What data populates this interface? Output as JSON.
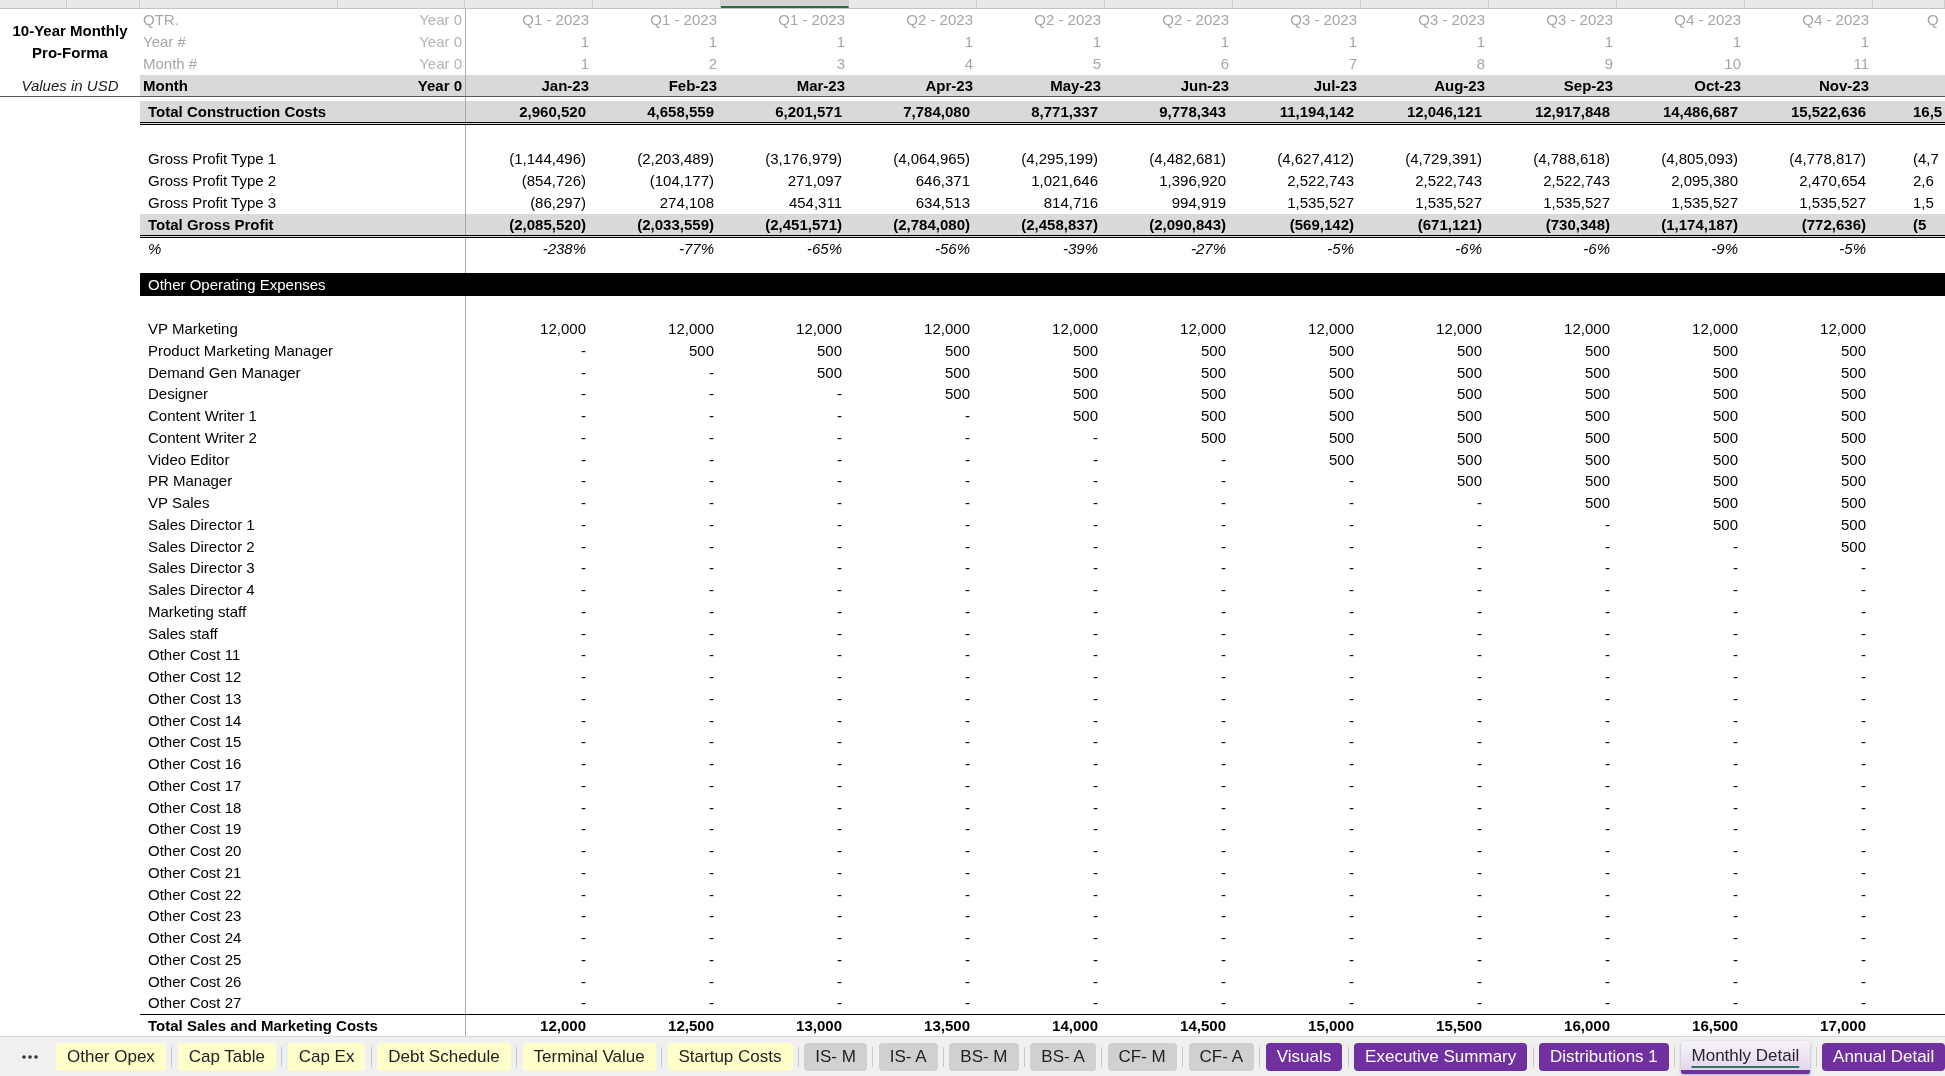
{
  "column_headers": [
    {
      "selected": false
    },
    {
      "selected": false
    },
    {
      "selected": true
    },
    {
      "selected": false
    },
    {
      "selected": false
    },
    {
      "selected": false
    },
    {
      "selected": false
    },
    {
      "selected": false
    },
    {
      "selected": false
    },
    {
      "selected": false
    },
    {
      "selected": false
    },
    {
      "selected": false
    }
  ],
  "title": "10-Year Monthly Pro-Forma",
  "units": "Values in USD",
  "header_rows": [
    {
      "kind": "index",
      "label": "QTR.",
      "base": "Year 0",
      "values": [
        "Q1 - 2023",
        "Q1 - 2023",
        "Q1 - 2023",
        "Q2 - 2023",
        "Q2 - 2023",
        "Q2 - 2023",
        "Q3 - 2023",
        "Q3 - 2023",
        "Q3 - 2023",
        "Q4 - 2023",
        "Q4 - 2023",
        "Q"
      ]
    },
    {
      "kind": "index",
      "label": "Year #",
      "base": "Year 0",
      "values": [
        "1",
        "1",
        "1",
        "1",
        "1",
        "1",
        "1",
        "1",
        "1",
        "1",
        "1"
      ]
    },
    {
      "kind": "index",
      "label": "Month #",
      "base": "Year 0",
      "values": [
        "1",
        "2",
        "3",
        "4",
        "5",
        "6",
        "7",
        "8",
        "9",
        "10",
        "11"
      ]
    },
    {
      "kind": "heading",
      "label": "Month",
      "base": "Year 0",
      "values": [
        "Jan-23",
        "Feb-23",
        "Mar-23",
        "Apr-23",
        "May-23",
        "Jun-23",
        "Jul-23",
        "Aug-23",
        "Sep-23",
        "Oct-23",
        "Nov-23"
      ]
    }
  ],
  "construction": [
    {
      "kind": "total",
      "label": "Total Construction Costs",
      "values": [
        "2,960,520",
        "4,658,559",
        "6,201,571",
        "7,784,080",
        "8,771,337",
        "9,778,343",
        "11,194,142",
        "12,046,121",
        "12,917,848",
        "14,486,687",
        "15,522,636",
        "16,5"
      ]
    }
  ],
  "gross_profit": [
    {
      "kind": "line",
      "label": "Gross Profit Type 1",
      "values": [
        "(1,144,496)",
        "(2,203,489)",
        "(3,176,979)",
        "(4,064,965)",
        "(4,295,199)",
        "(4,482,681)",
        "(4,627,412)",
        "(4,729,391)",
        "(4,788,618)",
        "(4,805,093)",
        "(4,778,817)",
        "(4,7"
      ]
    },
    {
      "kind": "line",
      "label": "Gross Profit Type 2",
      "values": [
        "(854,726)",
        "(104,177)",
        "271,097",
        "646,371",
        "1,021,646",
        "1,396,920",
        "2,522,743",
        "2,522,743",
        "2,522,743",
        "2,095,380",
        "2,470,654",
        "2,6"
      ]
    },
    {
      "kind": "line",
      "label": "Gross Profit Type 3",
      "values": [
        "(86,297)",
        "274,108",
        "454,311",
        "634,513",
        "814,716",
        "994,919",
        "1,535,527",
        "1,535,527",
        "1,535,527",
        "1,535,527",
        "1,535,527",
        "1,5"
      ]
    },
    {
      "kind": "total",
      "label": "Total Gross Profit",
      "values": [
        "(2,085,520)",
        "(2,033,559)",
        "(2,451,571)",
        "(2,784,080)",
        "(2,458,837)",
        "(2,090,843)",
        "(569,142)",
        "(671,121)",
        "(730,348)",
        "(1,174,187)",
        "(772,636)",
        "(5"
      ]
    },
    {
      "kind": "percent",
      "label": "%",
      "values": [
        "-238%",
        "-77%",
        "-65%",
        "-56%",
        "-39%",
        "-27%",
        "-5%",
        "-6%",
        "-6%",
        "-9%",
        "-5%"
      ]
    }
  ],
  "section": {
    "title": "Other Operating Expenses"
  },
  "expenses": [
    {
      "kind": "line",
      "label": "VP Marketing",
      "values": [
        "12,000",
        "12,000",
        "12,000",
        "12,000",
        "12,000",
        "12,000",
        "12,000",
        "12,000",
        "12,000",
        "12,000",
        "12,000"
      ]
    },
    {
      "kind": "line",
      "label": "Product Marketing Manager",
      "values": [
        "-",
        "500",
        "500",
        "500",
        "500",
        "500",
        "500",
        "500",
        "500",
        "500",
        "500"
      ]
    },
    {
      "kind": "line",
      "label": "Demand Gen Manager",
      "values": [
        "-",
        "-",
        "500",
        "500",
        "500",
        "500",
        "500",
        "500",
        "500",
        "500",
        "500"
      ]
    },
    {
      "kind": "line",
      "label": "Designer",
      "values": [
        "-",
        "-",
        "-",
        "500",
        "500",
        "500",
        "500",
        "500",
        "500",
        "500",
        "500"
      ]
    },
    {
      "kind": "line",
      "label": "Content Writer 1",
      "values": [
        "-",
        "-",
        "-",
        "-",
        "500",
        "500",
        "500",
        "500",
        "500",
        "500",
        "500"
      ]
    },
    {
      "kind": "line",
      "label": "Content Writer 2",
      "values": [
        "-",
        "-",
        "-",
        "-",
        "-",
        "500",
        "500",
        "500",
        "500",
        "500",
        "500"
      ]
    },
    {
      "kind": "line",
      "label": "Video Editor",
      "values": [
        "-",
        "-",
        "-",
        "-",
        "-",
        "-",
        "500",
        "500",
        "500",
        "500",
        "500"
      ]
    },
    {
      "kind": "line",
      "label": "PR Manager",
      "values": [
        "-",
        "-",
        "-",
        "-",
        "-",
        "-",
        "-",
        "500",
        "500",
        "500",
        "500"
      ]
    },
    {
      "kind": "line",
      "label": "VP Sales",
      "values": [
        "-",
        "-",
        "-",
        "-",
        "-",
        "-",
        "-",
        "-",
        "500",
        "500",
        "500"
      ]
    },
    {
      "kind": "line",
      "label": "Sales Director 1",
      "values": [
        "-",
        "-",
        "-",
        "-",
        "-",
        "-",
        "-",
        "-",
        "-",
        "500",
        "500"
      ]
    },
    {
      "kind": "line",
      "label": "Sales Director 2",
      "values": [
        "-",
        "-",
        "-",
        "-",
        "-",
        "-",
        "-",
        "-",
        "-",
        "-",
        "500"
      ]
    },
    {
      "kind": "line",
      "label": "Sales Director 3",
      "values": [
        "-",
        "-",
        "-",
        "-",
        "-",
        "-",
        "-",
        "-",
        "-",
        "-",
        "-"
      ]
    },
    {
      "kind": "line",
      "label": "Sales Director 4",
      "values": [
        "-",
        "-",
        "-",
        "-",
        "-",
        "-",
        "-",
        "-",
        "-",
        "-",
        "-"
      ]
    },
    {
      "kind": "line",
      "label": "Marketing staff",
      "values": [
        "-",
        "-",
        "-",
        "-",
        "-",
        "-",
        "-",
        "-",
        "-",
        "-",
        "-"
      ]
    },
    {
      "kind": "line",
      "label": "Sales staff",
      "values": [
        "-",
        "-",
        "-",
        "-",
        "-",
        "-",
        "-",
        "-",
        "-",
        "-",
        "-"
      ]
    },
    {
      "kind": "line",
      "label": "Other Cost 11",
      "values": [
        "-",
        "-",
        "-",
        "-",
        "-",
        "-",
        "-",
        "-",
        "-",
        "-",
        "-"
      ]
    },
    {
      "kind": "line",
      "label": "Other Cost 12",
      "values": [
        "-",
        "-",
        "-",
        "-",
        "-",
        "-",
        "-",
        "-",
        "-",
        "-",
        "-"
      ]
    },
    {
      "kind": "line",
      "label": "Other Cost 13",
      "values": [
        "-",
        "-",
        "-",
        "-",
        "-",
        "-",
        "-",
        "-",
        "-",
        "-",
        "-"
      ]
    },
    {
      "kind": "line",
      "label": "Other Cost 14",
      "values": [
        "-",
        "-",
        "-",
        "-",
        "-",
        "-",
        "-",
        "-",
        "-",
        "-",
        "-"
      ]
    },
    {
      "kind": "line",
      "label": "Other Cost 15",
      "values": [
        "-",
        "-",
        "-",
        "-",
        "-",
        "-",
        "-",
        "-",
        "-",
        "-",
        "-"
      ]
    },
    {
      "kind": "line",
      "label": "Other Cost 16",
      "values": [
        "-",
        "-",
        "-",
        "-",
        "-",
        "-",
        "-",
        "-",
        "-",
        "-",
        "-"
      ]
    },
    {
      "kind": "line",
      "label": "Other Cost 17",
      "values": [
        "-",
        "-",
        "-",
        "-",
        "-",
        "-",
        "-",
        "-",
        "-",
        "-",
        "-"
      ]
    },
    {
      "kind": "line",
      "label": "Other Cost 18",
      "values": [
        "-",
        "-",
        "-",
        "-",
        "-",
        "-",
        "-",
        "-",
        "-",
        "-",
        "-"
      ]
    },
    {
      "kind": "line",
      "label": "Other Cost 19",
      "values": [
        "-",
        "-",
        "-",
        "-",
        "-",
        "-",
        "-",
        "-",
        "-",
        "-",
        "-"
      ]
    },
    {
      "kind": "line",
      "label": "Other Cost 20",
      "values": [
        "-",
        "-",
        "-",
        "-",
        "-",
        "-",
        "-",
        "-",
        "-",
        "-",
        "-"
      ]
    },
    {
      "kind": "line",
      "label": "Other Cost 21",
      "values": [
        "-",
        "-",
        "-",
        "-",
        "-",
        "-",
        "-",
        "-",
        "-",
        "-",
        "-"
      ]
    },
    {
      "kind": "line",
      "label": "Other Cost 22",
      "values": [
        "-",
        "-",
        "-",
        "-",
        "-",
        "-",
        "-",
        "-",
        "-",
        "-",
        "-"
      ]
    },
    {
      "kind": "line",
      "label": "Other Cost 23",
      "values": [
        "-",
        "-",
        "-",
        "-",
        "-",
        "-",
        "-",
        "-",
        "-",
        "-",
        "-"
      ]
    },
    {
      "kind": "line",
      "label": "Other Cost 24",
      "values": [
        "-",
        "-",
        "-",
        "-",
        "-",
        "-",
        "-",
        "-",
        "-",
        "-",
        "-"
      ]
    },
    {
      "kind": "line",
      "label": "Other Cost 25",
      "values": [
        "-",
        "-",
        "-",
        "-",
        "-",
        "-",
        "-",
        "-",
        "-",
        "-",
        "-"
      ]
    },
    {
      "kind": "line",
      "label": "Other Cost 26",
      "values": [
        "-",
        "-",
        "-",
        "-",
        "-",
        "-",
        "-",
        "-",
        "-",
        "-",
        "-"
      ]
    },
    {
      "kind": "line",
      "label": "Other Cost 27",
      "values": [
        "-",
        "-",
        "-",
        "-",
        "-",
        "-",
        "-",
        "-",
        "-",
        "-",
        "-"
      ]
    },
    {
      "kind": "sum",
      "label": "Total Sales and Marketing Costs",
      "values": [
        "12,000",
        "12,500",
        "13,000",
        "13,500",
        "14,000",
        "14,500",
        "15,000",
        "15,500",
        "16,000",
        "16,500",
        "17,000"
      ]
    }
  ],
  "sheet_tabs": [
    {
      "label": "Other Opex",
      "color": "#ffffcc",
      "selected": false
    },
    {
      "label": "Cap Table",
      "color": "#ffffcc",
      "selected": false
    },
    {
      "label": "Cap Ex",
      "color": "#ffffcc",
      "selected": false
    },
    {
      "label": "Debt Schedule",
      "color": "#ffffcc",
      "selected": false
    },
    {
      "label": "Terminal Value",
      "color": "#ffffcc",
      "selected": false
    },
    {
      "label": "Startup Costs",
      "color": "#ffffcc",
      "selected": false
    },
    {
      "label": "IS- M",
      "color": "#d0d0d0",
      "selected": false
    },
    {
      "label": "IS- A",
      "color": "#d0d0d0",
      "selected": false
    },
    {
      "label": "BS- M",
      "color": "#d0d0d0",
      "selected": false
    },
    {
      "label": "BS- A",
      "color": "#d0d0d0",
      "selected": false
    },
    {
      "label": "CF- M",
      "color": "#d0d0d0",
      "selected": false
    },
    {
      "label": "CF- A",
      "color": "#d0d0d0",
      "selected": false
    },
    {
      "label": "Visuals",
      "color": "#7030a0",
      "selected": false
    },
    {
      "label": "Executive Summary",
      "color": "#7030a0",
      "selected": false
    },
    {
      "label": "Distributions 1",
      "color": "#7030a0",
      "selected": false
    },
    {
      "label": "Monthly Detail",
      "color": "#7030a0",
      "selected": true
    },
    {
      "label": "Annual Detail",
      "color": "#7030a0",
      "selected": false
    }
  ]
}
